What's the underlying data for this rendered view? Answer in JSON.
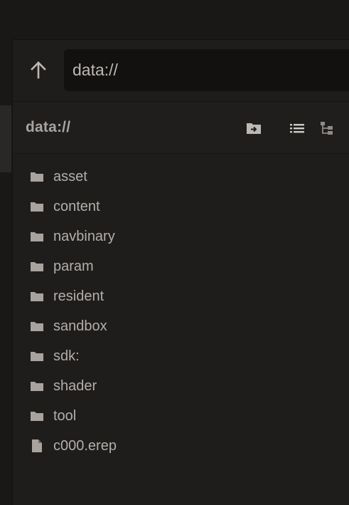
{
  "address_bar": {
    "value": "data://"
  },
  "path_header": {
    "title": "data://"
  },
  "toolbar": {
    "icons": [
      "move-to-folder-icon",
      "list-view-icon",
      "tree-view-icon"
    ]
  },
  "files": [
    {
      "name": "asset",
      "type": "folder"
    },
    {
      "name": "content",
      "type": "folder"
    },
    {
      "name": "navbinary",
      "type": "folder"
    },
    {
      "name": "param",
      "type": "folder"
    },
    {
      "name": "resident",
      "type": "folder"
    },
    {
      "name": "sandbox",
      "type": "folder"
    },
    {
      "name": "sdk:",
      "type": "folder"
    },
    {
      "name": "shader",
      "type": "folder"
    },
    {
      "name": "tool",
      "type": "folder"
    },
    {
      "name": "c000.erep",
      "type": "file"
    }
  ],
  "colors": {
    "background": "#1a1817",
    "panel": "#1f1d1b",
    "input": "#121110",
    "text": "#b3aeaa",
    "icon": "#bdb8b3"
  }
}
